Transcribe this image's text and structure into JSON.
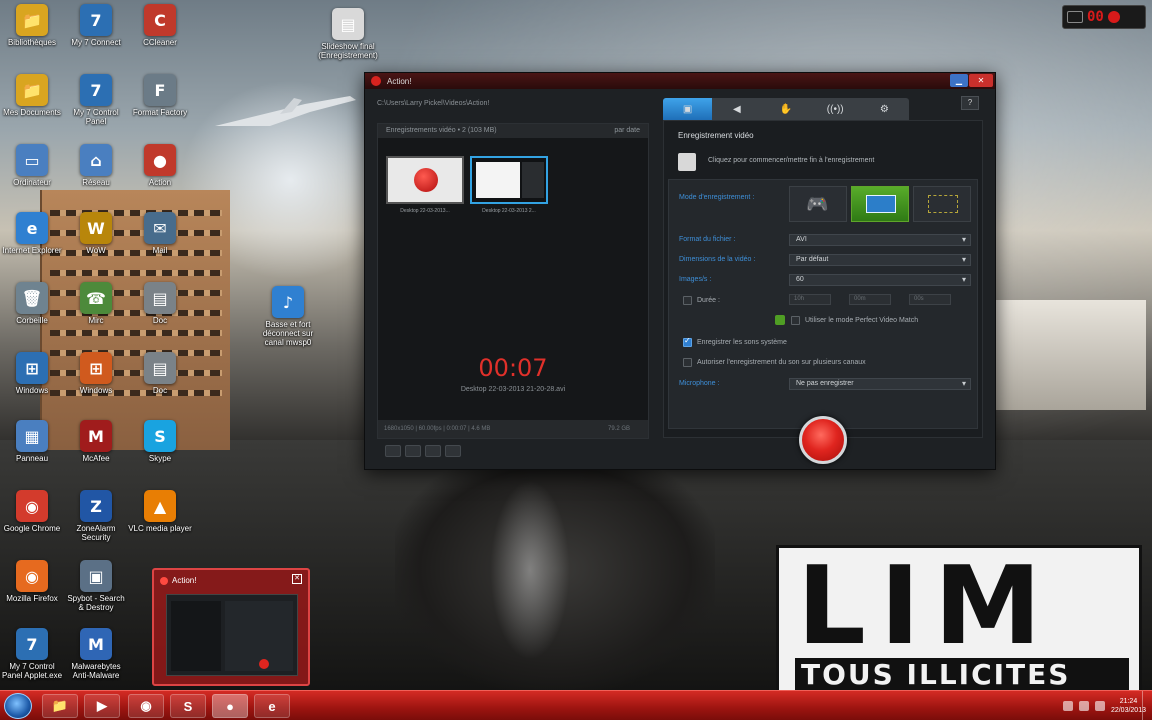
{
  "desktop": {
    "icons": [
      {
        "label": "Bibliothèques",
        "glyph": "📁",
        "color": "#d9a520"
      },
      {
        "label": "My 7 Connect",
        "glyph": "7",
        "color": "#2c6fb3"
      },
      {
        "label": "CCleaner",
        "glyph": "C",
        "color": "#c0392b"
      },
      {
        "label": "Mes Documents",
        "glyph": "📁",
        "color": "#d9a520"
      },
      {
        "label": "My 7 Control Panel",
        "glyph": "7",
        "color": "#2c6fb3"
      },
      {
        "label": "Format Factory",
        "glyph": "F",
        "color": "#6b7b87"
      },
      {
        "label": "Ordinateur",
        "glyph": "▭",
        "color": "#4a7fc0"
      },
      {
        "label": "Réseau",
        "glyph": "⌂",
        "color": "#4a7fc0"
      },
      {
        "label": "Action",
        "glyph": "●",
        "color": "#c0392b"
      },
      {
        "label": "Internet Explorer",
        "glyph": "e",
        "color": "#2f80d1"
      },
      {
        "label": "WoW",
        "glyph": "W",
        "color": "#b8860b"
      },
      {
        "label": "Mail",
        "glyph": "✉",
        "color": "#486c8c"
      },
      {
        "label": "Corbeille",
        "glyph": "🗑",
        "color": "#6f8390"
      },
      {
        "label": "Mirc",
        "glyph": "☎",
        "color": "#4d8a3b"
      },
      {
        "label": "Doc",
        "glyph": "▤",
        "color": "#7a8288"
      },
      {
        "label": "Windows",
        "glyph": "⊞",
        "color": "#2c6fb3"
      },
      {
        "label": "Windows",
        "glyph": "⊞",
        "color": "#d05a1e"
      },
      {
        "label": "Doc",
        "glyph": "▤",
        "color": "#7a8288"
      },
      {
        "label": "Panneau",
        "glyph": "▦",
        "color": "#4a7fc0"
      },
      {
        "label": "McAfee",
        "glyph": "M",
        "color": "#a01c1c"
      },
      {
        "label": "Skype",
        "glyph": "S",
        "color": "#19a3e0"
      },
      {
        "label": "Google Chrome",
        "glyph": "◉",
        "color": "#d33b2c"
      },
      {
        "label": "ZoneAlarm Security",
        "glyph": "Z",
        "color": "#2156a5"
      },
      {
        "label": "VLC media player",
        "glyph": "▲",
        "color": "#e87e04"
      },
      {
        "label": "Mozilla Firefox",
        "glyph": "◉",
        "color": "#e66a1f"
      },
      {
        "label": "Spybot - Search & Destroy",
        "glyph": "▣",
        "color": "#5b7086"
      },
      {
        "label": "My 7 Control Panel Applet.exe",
        "glyph": "7",
        "color": "#2c6fb3"
      },
      {
        "label": "Malwarebytes Anti-Malware",
        "glyph": "M",
        "color": "#2f66b5"
      },
      {
        "label": "Slideshow final (Enregistrement)",
        "glyph": "▤",
        "color": "#d9d9d9"
      },
      {
        "label": "Basse et fort déconnect sur canal mwsp0",
        "glyph": "♪",
        "color": "#2f80d1"
      }
    ]
  },
  "recorder_widget": {
    "digits": "00"
  },
  "app": {
    "title": "Action!",
    "path": "C:\\Users\\Larry Pickel\\Videos\\Action!",
    "list_header": "Enregistrements vidéo • 2 (103 MB)",
    "sort_label": "par date",
    "thumbs": [
      {
        "label": "Desktop 22-03-2013..."
      },
      {
        "label": "Desktop 22-03-2013 2..."
      }
    ],
    "timer": "00:07",
    "timer_file": "Desktop 22-03-2013 21-20-28.avi",
    "footer_info": "1680x1050 | 60.00fps | 0:00:07 | 4.6 MB",
    "footer_size": "79.2 GB",
    "tabs": [
      {
        "label": "▣"
      },
      {
        "label": "◀"
      },
      {
        "label": "✋"
      },
      {
        "label": "((•))"
      },
      {
        "label": "⚙"
      }
    ],
    "help": "?",
    "section_title": "Enregistrement vidéo",
    "hint": "Cliquez pour commencer/mettre fin à l'enregistrement",
    "settings": {
      "mode_label": "Mode d'enregistrement :",
      "format_label": "Format du fichier :",
      "format_value": "AVI",
      "size_label": "Dimensions de la vidéo :",
      "size_value": "Par défaut",
      "fps_label": "Images/s :",
      "fps_value": "60",
      "duration_label": "Durée :",
      "duration_values": [
        "10h",
        "00m",
        "00s"
      ],
      "perfect_label": "Utiliser le mode Perfect Video Match",
      "sound_label": "Enregistrer les sons système",
      "multi_label": "Autoriser l'enregistrement du son sur plusieurs canaux",
      "mic_label": "Microphone :",
      "mic_value": "Ne pas enregistrer"
    }
  },
  "preview": {
    "title": "Action!",
    "close": "✕"
  },
  "logo": {
    "main": "LIM",
    "sub": "TOUS ILLICITES"
  },
  "taskbar": {
    "buttons": [
      {
        "glyph": "📁"
      },
      {
        "glyph": "▶"
      },
      {
        "glyph": "◉"
      },
      {
        "glyph": "S"
      },
      {
        "glyph": "●"
      },
      {
        "glyph": "e"
      }
    ],
    "time": "21:24",
    "date": "22/03/2013"
  },
  "colors": {
    "accent": "#d42b24",
    "timer": "#e0302a",
    "tab_active": "#2f8ad6"
  }
}
